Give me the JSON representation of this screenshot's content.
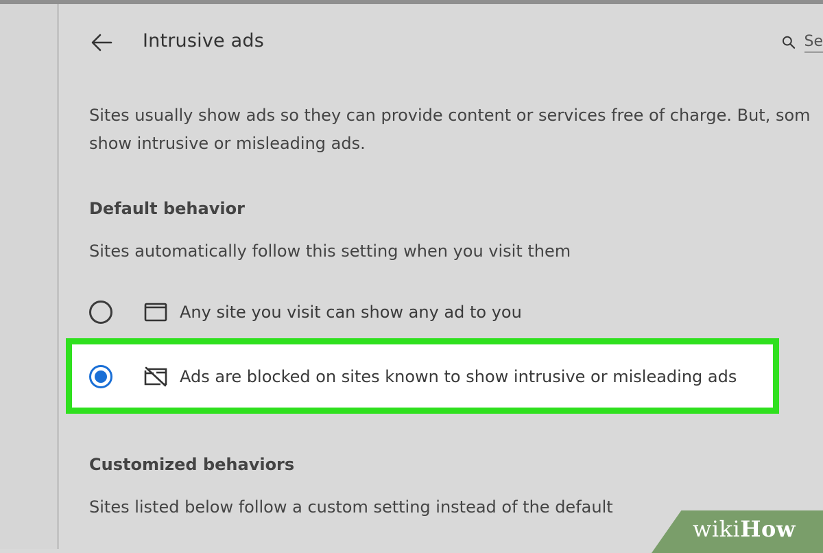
{
  "page": {
    "title": "Intrusive ads",
    "search_placeholder": "Se"
  },
  "description": {
    "line1": "Sites usually show ads so they can provide content or services free of charge. But, som",
    "line2": "show intrusive or misleading ads."
  },
  "default_behavior": {
    "heading": "Default behavior",
    "subtext": "Sites automatically follow this setting when you visit them",
    "options": [
      {
        "label": "Any site you visit can show any ad to you",
        "icon": "window-icon",
        "selected": false
      },
      {
        "label": "Ads are blocked on sites known to show intrusive or misleading ads",
        "icon": "ads-blocked-icon",
        "selected": true
      }
    ]
  },
  "customized_behaviors": {
    "heading": "Customized behaviors",
    "subtext": "Sites listed below follow a custom setting instead of the default"
  },
  "watermark": {
    "wiki": "wiki",
    "how": "How"
  },
  "colors": {
    "highlight_border": "#2fe01e",
    "radio_selected": "#1a6fd6",
    "background": "#d9d9d9"
  }
}
